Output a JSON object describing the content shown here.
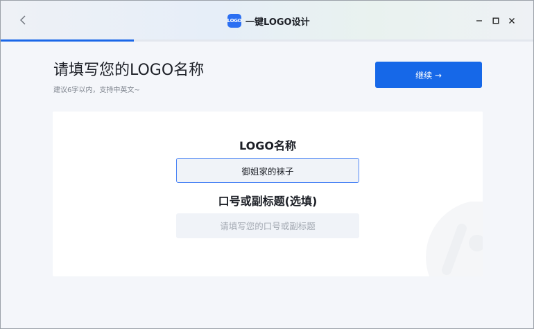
{
  "window": {
    "app_title": "一键LOGO设计",
    "app_logo_text": "LOGO",
    "accent_color": "#1668e8",
    "progress": 0.25
  },
  "icons": {
    "back": "chevron-left-icon",
    "minimize": "minimize-icon",
    "maximize": "maximize-icon",
    "close": "close-icon"
  },
  "page": {
    "heading": "请填写您的LOGO名称",
    "subheading": "建议6字以内，支持中英文~",
    "continue_label": "继续 →"
  },
  "form": {
    "name_label": "LOGO名称",
    "name_value": "御姐家的袜子",
    "slogan_label": "口号或副标题(选填)",
    "slogan_value": "",
    "slogan_placeholder": "请填写您的口号或副标题"
  }
}
